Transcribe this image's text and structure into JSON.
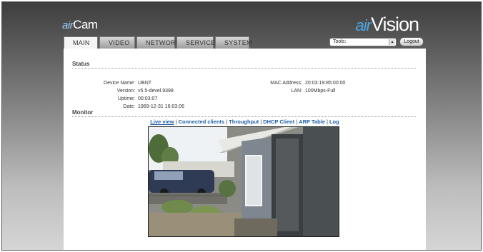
{
  "brand": {
    "left_prefix": "air",
    "left_name": "Cam",
    "right_prefix": "air",
    "right_name": "Vision"
  },
  "tabs": [
    {
      "label": "MAIN",
      "active": true
    },
    {
      "label": "VIDEO",
      "active": false
    },
    {
      "label": "NETWORK",
      "active": false
    },
    {
      "label": "SERVICES",
      "active": false
    },
    {
      "label": "SYSTEM",
      "active": false
    }
  ],
  "toolbar": {
    "tools_label": "Tools:",
    "logout_label": "Logout"
  },
  "status": {
    "title": "Status",
    "device_name_label": "Device Name:",
    "device_name": "UBNT",
    "version_label": "Version:",
    "version": "v5.5-devel.9398",
    "uptime_label": "Uptime:",
    "uptime": "00:03:07",
    "date_label": "Date:",
    "date": "1969-12-31 16:03:06",
    "mac_label": "MAC Address:",
    "mac": "20:03:19:85:00:00",
    "lan_label": "LAN:",
    "lan": "100Mbps-Full"
  },
  "monitor": {
    "title": "Monitor",
    "links": [
      "Live view",
      "Connected clients",
      "Throughput",
      "DHCP Client",
      "ARP Table",
      "Log"
    ],
    "separator": "|"
  },
  "colors": {
    "link": "#1f5fa8",
    "brand_accent": "#4fa6e8"
  }
}
